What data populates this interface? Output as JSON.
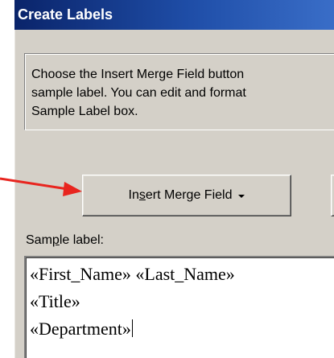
{
  "window": {
    "title": "Create Labels"
  },
  "instructions": {
    "lines": [
      "Choose the Insert Merge Field button",
      "sample label.  You can edit and format",
      "Sample Label box."
    ]
  },
  "insert_merge_field": {
    "label_before": "In",
    "label_underlined": "s",
    "label_after": "ert Merge Field",
    "icon": "chevron-down-icon"
  },
  "sample_label": {
    "caption_before": "Sam",
    "caption_underlined": "p",
    "caption_after": "le label:",
    "lines": [
      "«First_Name» «Last_Name»",
      "«Title»",
      "«Department»"
    ]
  },
  "colors": {
    "title_bar": "#0a246a",
    "dialog_face": "#d4d0c8",
    "annotation_arrow": "#e8251f"
  }
}
